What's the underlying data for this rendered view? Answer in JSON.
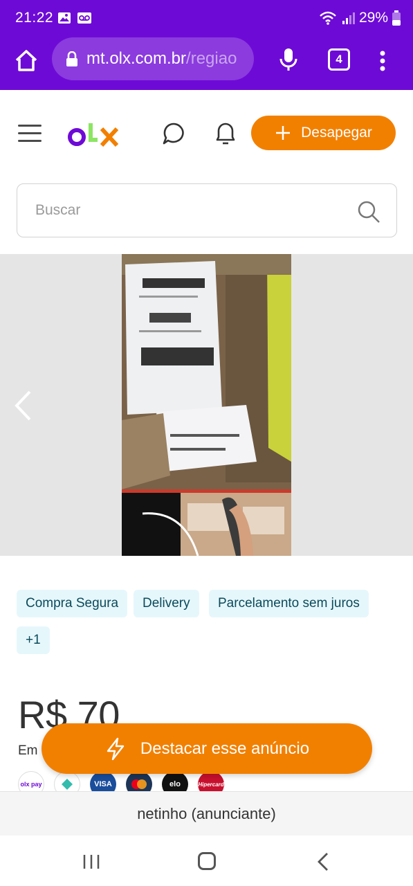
{
  "status_bar": {
    "time": "21:22",
    "battery": "29%"
  },
  "browser": {
    "url_host": "mt.olx.com.br",
    "url_rest": "/regiao",
    "tab_count": "4"
  },
  "header": {
    "post_button_label": "Desapegar"
  },
  "search": {
    "placeholder": "Buscar"
  },
  "badges": [
    "Compra Segura",
    "Delivery",
    "Parcelamento sem juros",
    "+1"
  ],
  "listing": {
    "price": "R$ 70",
    "payment_prefix": "Em"
  },
  "payment_methods": [
    "olx pay",
    "pix",
    "VISA",
    "mastercard",
    "elo",
    "Hipercard"
  ],
  "promote_button_label": "Destacar esse anúncio",
  "seller": {
    "name": "netinho",
    "role": "(anunciante)"
  },
  "colors": {
    "brand_purple": "#6e0ad6",
    "brand_orange": "#f28000",
    "badge_bg": "#e6f7fc"
  }
}
